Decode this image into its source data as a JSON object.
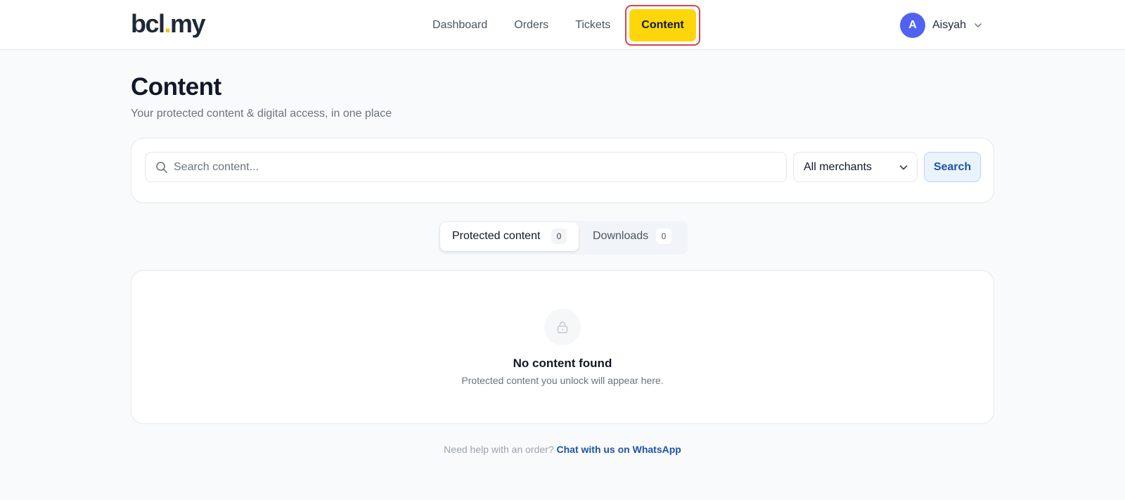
{
  "header": {
    "logo_main": "bcl",
    "logo_dot": ".",
    "logo_tail": "my",
    "nav": [
      {
        "label": "Dashboard"
      },
      {
        "label": "Orders"
      },
      {
        "label": "Tickets"
      },
      {
        "label": "Content",
        "active": true
      }
    ],
    "user": {
      "initial": "A",
      "name": "Aisyah"
    }
  },
  "page": {
    "title": "Content",
    "subtitle": "Your protected content & digital access, in one place"
  },
  "search": {
    "placeholder": "Search content...",
    "value": "",
    "merchant_selected": "All merchants",
    "button_label": "Search"
  },
  "tabs": [
    {
      "label": "Protected content",
      "count": "0",
      "active": true
    },
    {
      "label": "Downloads",
      "count": "0",
      "active": false
    }
  ],
  "empty_state": {
    "icon": "lock-icon",
    "title": "No content found",
    "text": "Protected content you unlock will appear here."
  },
  "footer": {
    "text": "Need help with an order?",
    "link_label": "Chat with us on WhatsApp"
  },
  "colors": {
    "accent": "#ffd60a",
    "link": "#1e55a6",
    "avatar": "#4f63f0",
    "highlight_border": "#d9434e"
  }
}
